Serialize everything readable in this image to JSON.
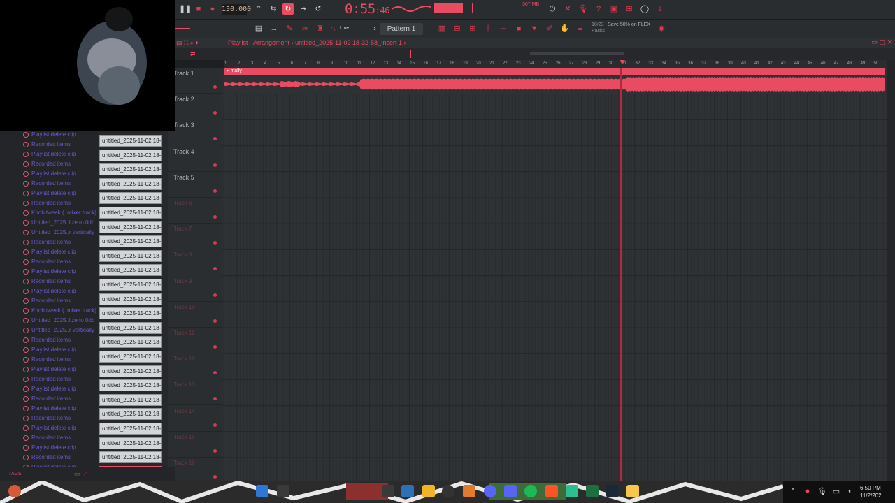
{
  "toolbar": {
    "bpm": "130.000",
    "time_main": "0:55",
    "time_frac": ":46",
    "cpu_label": "367 MB",
    "pattern": "Pattern 1",
    "snap_mode": "Line",
    "promo_line1": "10/23",
    "promo_line2": "Save 50% on FLEX",
    "promo_line3": "Packs"
  },
  "playlist": {
    "title": "Playlist - Arrangement",
    "project": "untitled_2025-11-02 18-32-58_Insert 1",
    "clip_name": "mally",
    "ruler": [
      "1",
      "2",
      "3",
      "4",
      "5",
      "6",
      "7",
      "8",
      "9",
      "10",
      "11",
      "12",
      "13",
      "14",
      "15",
      "16",
      "17",
      "18",
      "19",
      "20",
      "21",
      "22",
      "23",
      "24",
      "25",
      "26",
      "27",
      "28",
      "29",
      "30",
      "31",
      "32",
      "33",
      "34",
      "35",
      "36",
      "37",
      "38",
      "39",
      "40",
      "41",
      "42",
      "43",
      "44",
      "45",
      "46",
      "47",
      "48",
      "49",
      "50"
    ]
  },
  "tracks": [
    {
      "name": "Track 1",
      "dim": false
    },
    {
      "name": "Track 2",
      "dim": false
    },
    {
      "name": "Track 3",
      "dim": false
    },
    {
      "name": "Track 4",
      "dim": false
    },
    {
      "name": "Track 5",
      "dim": false
    },
    {
      "name": "Track 6",
      "dim": true
    },
    {
      "name": "Track 7",
      "dim": true
    },
    {
      "name": "Track 8",
      "dim": true
    },
    {
      "name": "Track 9",
      "dim": true
    },
    {
      "name": "Track 10",
      "dim": true
    },
    {
      "name": "Track 11",
      "dim": true
    },
    {
      "name": "Track 12",
      "dim": true
    },
    {
      "name": "Track 13",
      "dim": true
    },
    {
      "name": "Track 14",
      "dim": true
    },
    {
      "name": "Track 15",
      "dim": true
    },
    {
      "name": "Track 16",
      "dim": true
    }
  ],
  "history": [
    "Playlist delete clip",
    "Recorded items",
    "Playlist delete clip",
    "Recorded items",
    "Playlist delete clip",
    "Recorded items",
    "Playlist delete clip",
    "Recorded items",
    "Knob tweak (..mixer track)",
    "Untitled_2025..lize to 0db",
    "Untitled_2025..r vertically",
    "Recorded items",
    "Playlist delete clip",
    "Recorded items",
    "Playlist delete clip",
    "Recorded items",
    "Playlist delete clip",
    "Recorded items",
    "Knob tweak (..mixer track)",
    "Untitled_2025..lize to 0db",
    "Untitled_2025..r vertically",
    "Recorded items",
    "Playlist delete clip",
    "Recorded items",
    "Playlist delete clip",
    "Recorded items",
    "Playlist delete clip",
    "Recorded items",
    "Playlist delete clip",
    "Recorded items",
    "Playlist delete clip",
    "Recorded items",
    "Playlist delete clip",
    "Recorded items",
    "Playlist delete clip"
  ],
  "clips": [
    "untitled_2025-11-02 18-",
    "untitled_2025-11-02 18-",
    "untitled_2025-11-02 18-",
    "untitled_2025-11-02 18-",
    "untitled_2025-11-02 18-",
    "untitled_2025-11-02 18-",
    "untitled_2025-11-02 18-",
    "untitled_2025-11-02 18-",
    "untitled_2025-11-02 18-",
    "untitled_2025-11-02 18-",
    "untitled_2025-11-02 18-",
    "untitled_2025-11-02 18-",
    "untitled_2025-11-02 18-",
    "untitled_2025-11-02 18-",
    "untitled_2025-11-02 18-",
    "untitled_2025-11-02 18-",
    "untitled_2025-11-02 18-",
    "untitled_2025-11-02 18-",
    "untitled_2025-11-02 18-",
    "untitled_2025-11-02 18-",
    "untitled_2025-11-02 18-",
    "untitled_2025-11-02 18-",
    "untitled_2025-11-02 18-",
    "untitled_2025-11-02 18-"
  ],
  "browser": {
    "tags_label": "TAGS"
  },
  "taskbar": {
    "time": "6:50 PM",
    "date": "11/2/202"
  },
  "colors": {
    "accent": "#e94b62",
    "playhead": "#b3283c",
    "history_text": "#6a5ad2"
  }
}
